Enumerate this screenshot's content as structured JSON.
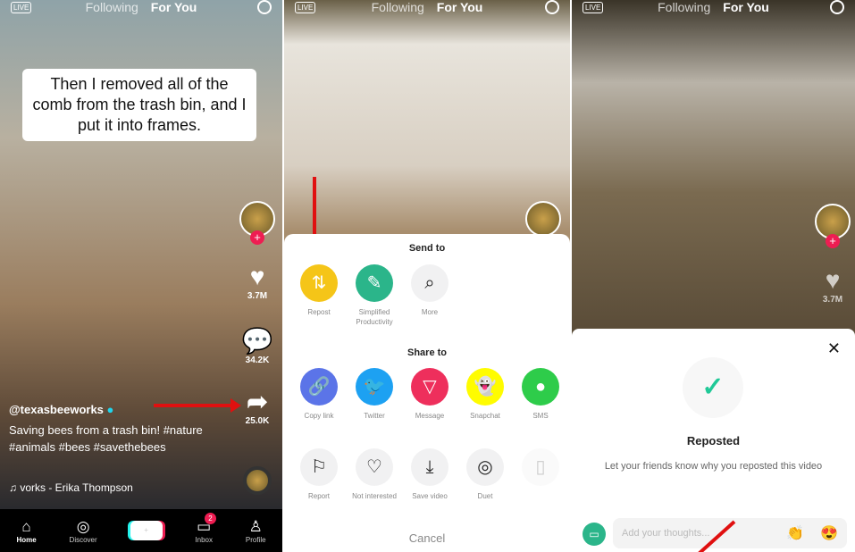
{
  "topbar": {
    "live": "LIVE",
    "following": "Following",
    "for_you": "For You"
  },
  "panel1": {
    "caption": "Then I removed all of the comb from the trash bin, and I put it into frames.",
    "likes": "3.7M",
    "comments": "34.2K",
    "shares": "25.0K",
    "username": "@texasbeeworks",
    "description": "Saving bees from a trash bin! #nature #animals #bees #savethebees",
    "music": "vorks - Erika Thompson",
    "nav": [
      {
        "label": "Home",
        "icon": "home-icon"
      },
      {
        "label": "Discover",
        "icon": "compass-icon"
      },
      {
        "label": "",
        "icon": "plus-icon"
      },
      {
        "label": "Inbox",
        "icon": "inbox-icon",
        "badge": "2"
      },
      {
        "label": "Profile",
        "icon": "person-icon"
      }
    ]
  },
  "panel2": {
    "send_to": "Send to",
    "send_items": [
      {
        "label": "Repost",
        "color": "#f5c518",
        "icon": "repost-icon"
      },
      {
        "label": "Simplified Productivity",
        "color": "#2bb58a",
        "icon": "notepad-icon"
      },
      {
        "label": "More",
        "color": "#f1f1f2",
        "icon": "search-icon"
      }
    ],
    "share_to": "Share to",
    "share_items": [
      {
        "label": "Copy link",
        "color": "#5b74e8",
        "icon": "link-icon"
      },
      {
        "label": "Twitter",
        "color": "#1da1f2",
        "icon": "twitter-icon"
      },
      {
        "label": "Message",
        "color": "#ee2f5c",
        "icon": "message-icon"
      },
      {
        "label": "Snapchat",
        "color": "#fffc00",
        "icon": "snapchat-icon"
      },
      {
        "label": "SMS",
        "color": "#2ecc4a",
        "icon": "sms-icon"
      }
    ],
    "action_items": [
      {
        "label": "Report",
        "icon": "flag-icon"
      },
      {
        "label": "Not interested",
        "icon": "broken-heart-icon"
      },
      {
        "label": "Save video",
        "icon": "download-icon"
      },
      {
        "label": "Duet",
        "icon": "duet-icon"
      },
      {
        "label": "",
        "icon": "stitch-icon"
      }
    ],
    "cancel": "Cancel"
  },
  "panel3": {
    "likes": "3.7M",
    "title": "Reposted",
    "subtitle": "Let your friends know why you reposted this video",
    "input_placeholder": "Add your thoughts...",
    "accent": "#20c997"
  }
}
